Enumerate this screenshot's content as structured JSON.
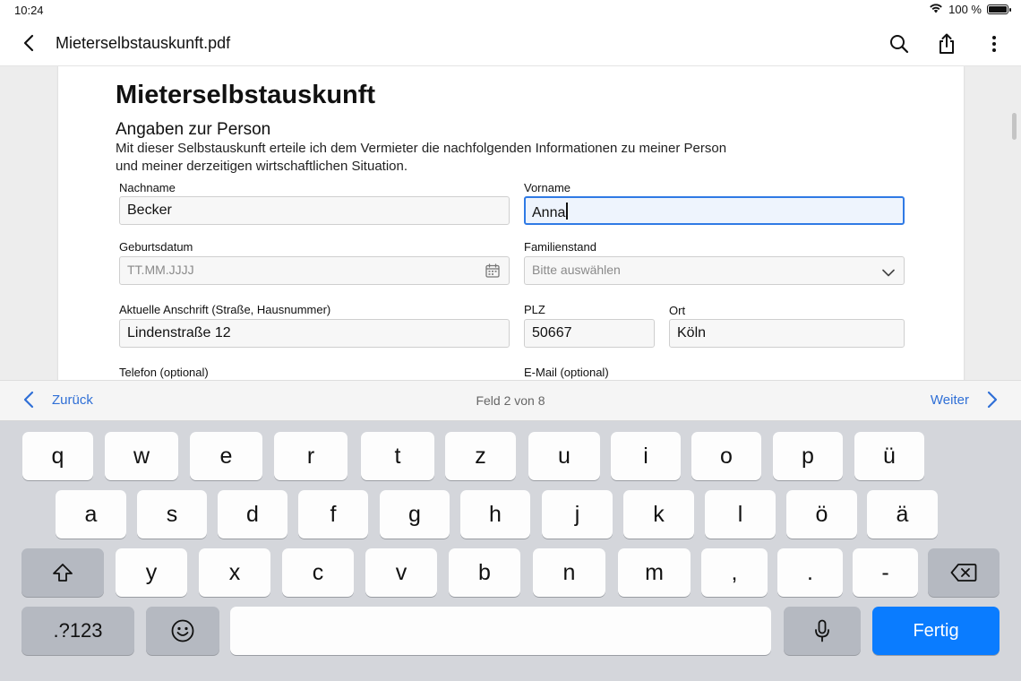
{
  "status": {
    "time": "10:24",
    "battery": "100 %"
  },
  "app_bar": {
    "title": "Mieterselbstauskunft.pdf"
  },
  "document": {
    "heading": "Mieterselbstauskunft",
    "section_title": "Angaben zur Person",
    "intro_line1": "Mit dieser Selbstauskunft erteile ich dem Vermieter die nachfolgenden Informationen zu meiner Person",
    "intro_line2": "und meiner derzeitigen wirtschaftlichen Situation.",
    "fields": {
      "nachname": {
        "label": "Nachname",
        "value": "Becker"
      },
      "vorname": {
        "label": "Vorname",
        "value": "Anna"
      },
      "geburtsdatum": {
        "label": "Geburtsdatum",
        "placeholder": "TT.MM.JJJJ"
      },
      "familienstand": {
        "label": "Familienstand",
        "placeholder": "Bitte auswählen"
      },
      "anschrift": {
        "label": "Aktuelle Anschrift (Straße, Hausnummer)",
        "value": "Lindenstraße 12"
      },
      "plz": {
        "label": "PLZ",
        "value": "50667"
      },
      "ort": {
        "label": "Ort",
        "value": "Köln"
      },
      "telefon": {
        "label": "Telefon (optional)"
      },
      "email": {
        "label": "E-Mail (optional)"
      }
    }
  },
  "form_nav": {
    "prev_label": "Zurück",
    "counter": "Feld 2 von 8",
    "next_label": "Weiter"
  },
  "keyboard": {
    "row1": [
      "q",
      "w",
      "e",
      "r",
      "t",
      "z",
      "u",
      "i",
      "o",
      "p",
      "ü"
    ],
    "row2": [
      "a",
      "s",
      "d",
      "f",
      "g",
      "h",
      "j",
      "k",
      "l",
      "ö",
      "ä"
    ],
    "row3": [
      "y",
      "x",
      "c",
      "v",
      "b",
      "n",
      "m",
      ",",
      ".",
      "-"
    ],
    "numbers_label": ".?123",
    "done_label": "Fertig"
  },
  "colors": {
    "accent": "#0a7cff",
    "link": "#2f6fd6",
    "active_field_border": "#2f7ae5"
  }
}
